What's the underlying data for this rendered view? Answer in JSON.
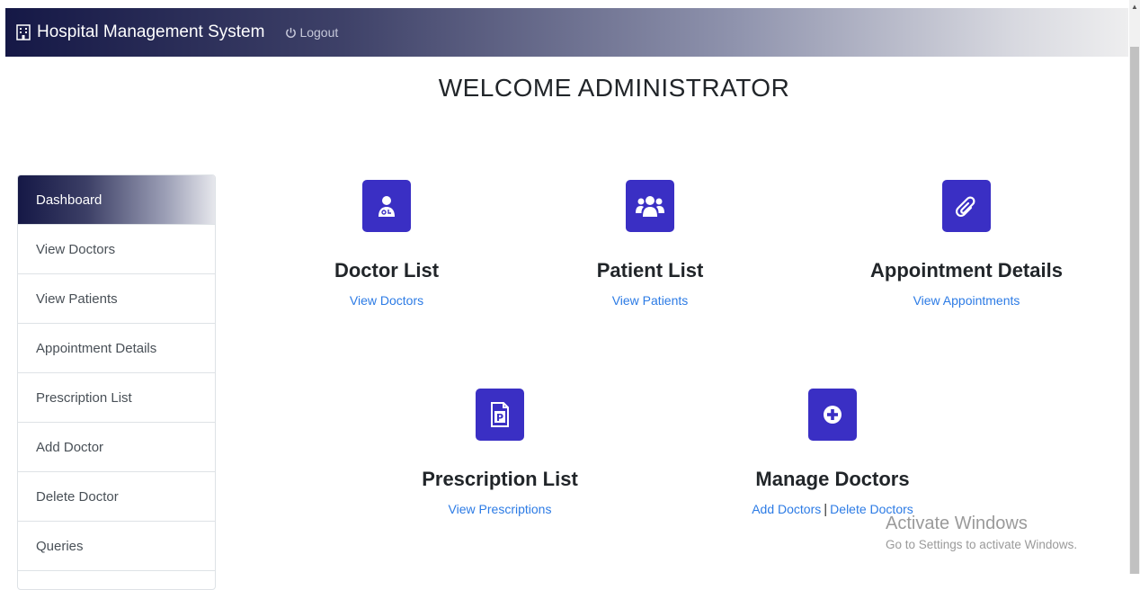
{
  "navbar": {
    "brand": "Hospital Management System",
    "logout": "Logout"
  },
  "page": {
    "title": "WELCOME ADMINISTRATOR"
  },
  "sidebar": {
    "items": [
      {
        "label": "Dashboard"
      },
      {
        "label": "View Doctors"
      },
      {
        "label": "View Patients"
      },
      {
        "label": "Appointment Details"
      },
      {
        "label": "Prescription List"
      },
      {
        "label": "Add Doctor"
      },
      {
        "label": "Delete Doctor"
      },
      {
        "label": "Queries"
      }
    ]
  },
  "cards": {
    "doctor": {
      "title": "Doctor List",
      "link": "View Doctors",
      "icon": "user-doctor-icon"
    },
    "patient": {
      "title": "Patient List",
      "link": "View Patients",
      "icon": "users-icon"
    },
    "appointment": {
      "title": "Appointment Details",
      "link": "View Appointments",
      "icon": "paperclip-icon"
    },
    "prescription": {
      "title": "Prescription List",
      "link": "View Prescriptions",
      "icon": "prescription-file-icon"
    },
    "manage": {
      "title": "Manage Doctors",
      "link_add": "Add Doctors",
      "separator": "|",
      "link_delete": "Delete Doctors",
      "icon": "plus-circle-icon"
    }
  },
  "watermark": {
    "line1": "Activate Windows",
    "line2": "Go to Settings to activate Windows."
  },
  "colors": {
    "accent": "#3a2fc4",
    "link": "#2c7be5",
    "navbar_dark": "#151846"
  }
}
